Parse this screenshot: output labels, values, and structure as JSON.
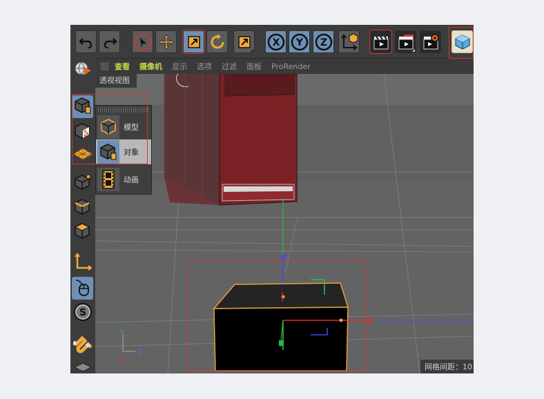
{
  "menu": {
    "items": [
      {
        "label": "查看",
        "active": true
      },
      {
        "label": "摄像机",
        "active": true
      },
      {
        "label": "显示",
        "active": false
      },
      {
        "label": "选项",
        "active": false
      },
      {
        "label": "过滤",
        "active": false
      },
      {
        "label": "面板",
        "active": false
      },
      {
        "label": "ProRender",
        "active": false
      }
    ]
  },
  "toolbar": {
    "undo": "undo-icon",
    "redo": "redo-icon",
    "axes": {
      "x": "X",
      "y": "Y",
      "z": "Z"
    }
  },
  "viewport": {
    "label": "透视视图",
    "grid_readout": "网格间距：10",
    "gizmo": {
      "y": "Y",
      "x": "X",
      "z": "Z"
    }
  },
  "popup": {
    "items": [
      {
        "label": "模型",
        "selected": false
      },
      {
        "label": "对象",
        "selected": true
      },
      {
        "label": "动画",
        "selected": false
      }
    ]
  },
  "colors": {
    "accent_blue": "#6e8fb6",
    "highlight_red": "#d43535",
    "menu_active": "#c8d84a",
    "object_orange": "#e8a23a"
  }
}
